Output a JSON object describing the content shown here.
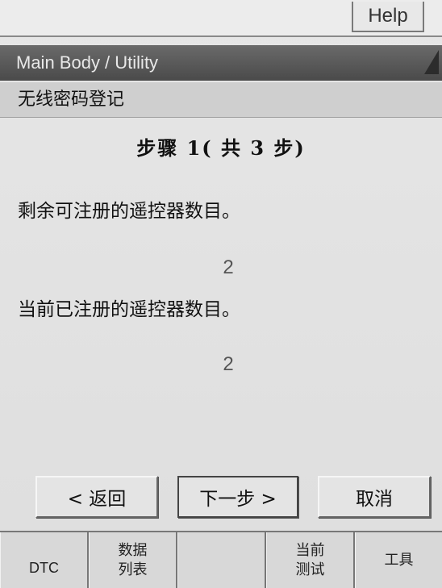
{
  "menu": {
    "help_label": "Help"
  },
  "window": {
    "title": "Main Body / Utility"
  },
  "page": {
    "subtitle": "无线密码登记"
  },
  "content": {
    "step_text": "步骤 1( 共 3 步)",
    "remaining_label": "剩余可注册的遥控器数目。",
    "remaining_value": "2",
    "registered_label": "当前已注册的遥控器数目。",
    "registered_value": "2"
  },
  "buttons": {
    "back": "< 返回",
    "next": "下一步 >",
    "cancel": "取消"
  },
  "toolbar": {
    "dtc": "DTC",
    "data_list_line1": "数据",
    "data_list_line2": "列表",
    "blank": "",
    "current_test_line1": "当前",
    "current_test_line2": "测试",
    "tools": "工具"
  }
}
